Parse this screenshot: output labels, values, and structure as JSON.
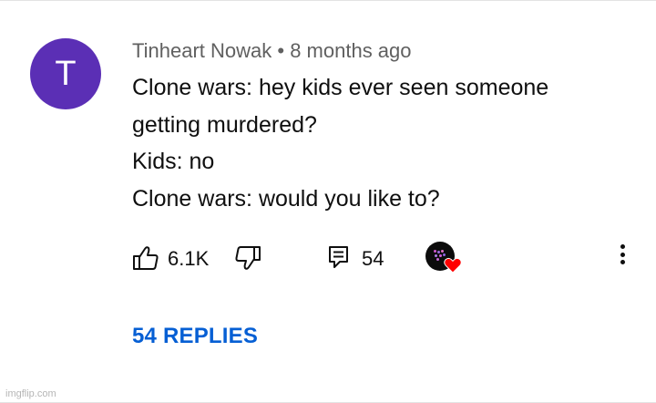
{
  "comment": {
    "avatar_letter": "T",
    "avatar_color": "#5b2fb5",
    "author": "Tinheart Nowak",
    "separator": "•",
    "time": "8 months ago",
    "lines": [
      "Clone wars: hey kids ever seen someone",
      "getting murdered?",
      "Kids: no",
      "Clone wars: would you like to?"
    ]
  },
  "actions": {
    "like_icon": "thumbs-up-icon",
    "like_count": "6.1K",
    "dislike_icon": "thumbs-down-icon",
    "reply_icon": "comment-icon",
    "reply_count": "54",
    "creator_heart_icon": "creator-heart-icon",
    "heart_color": "#ff0000",
    "more_icon": "more-vertical-icon"
  },
  "replies": {
    "label": "54 REPLIES",
    "color": "#065fd4"
  },
  "watermark": "imgflip.com"
}
